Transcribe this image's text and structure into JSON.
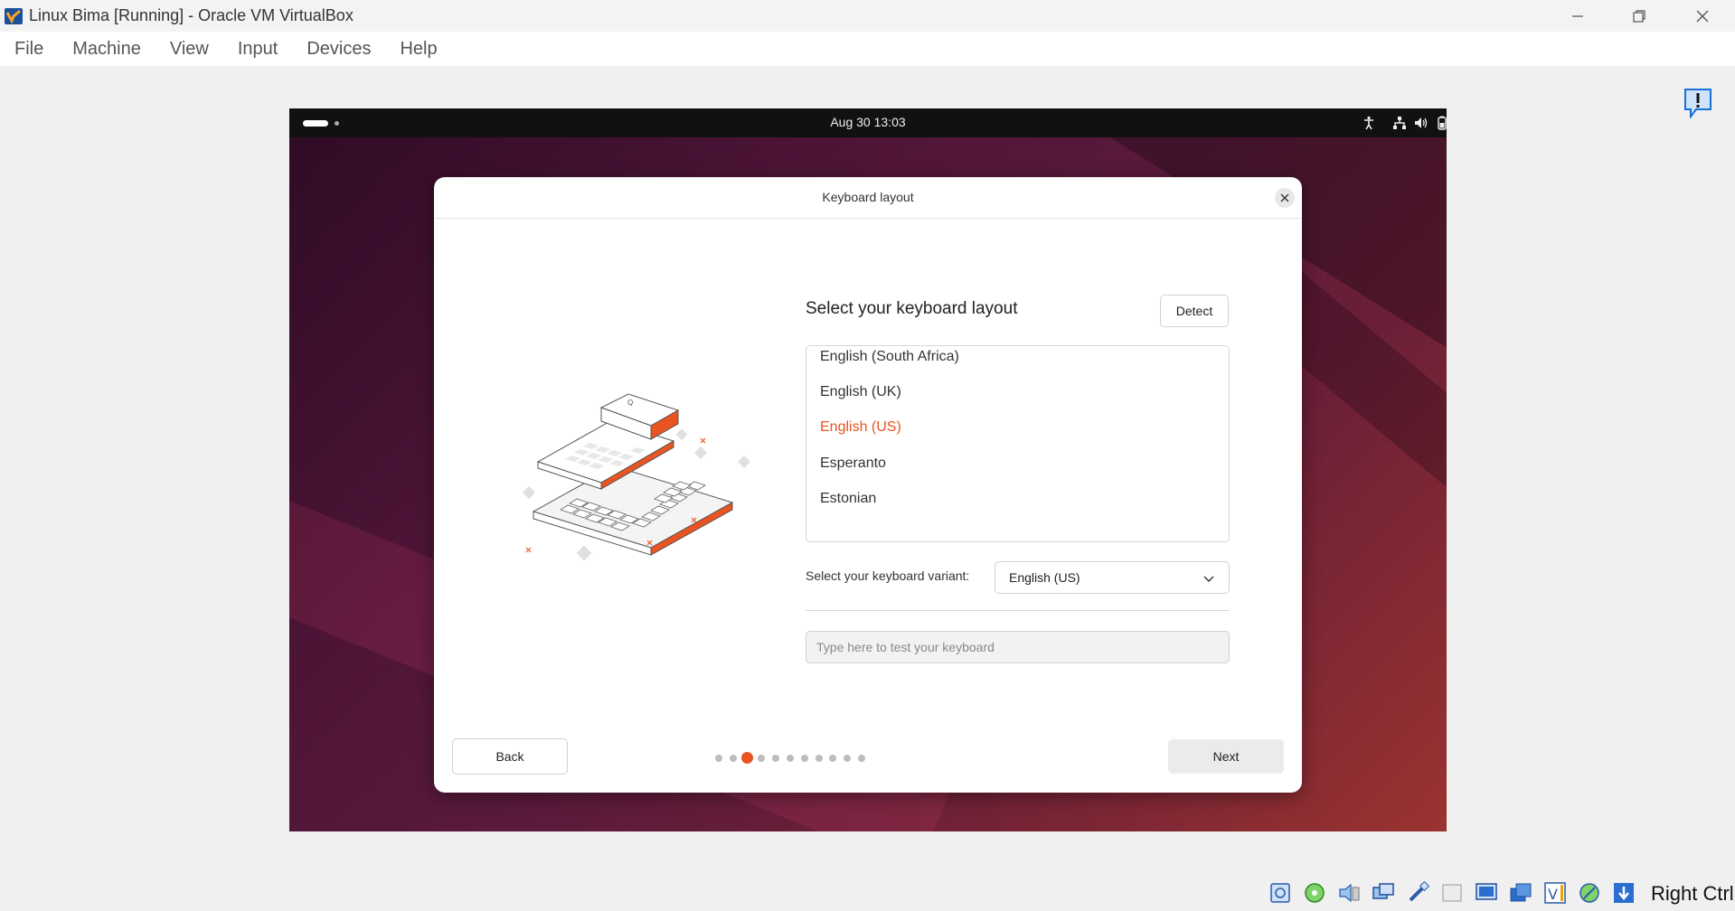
{
  "window": {
    "title": "Linux Bima [Running] - Oracle VM VirtualBox",
    "app_icon": "virtualbox-icon",
    "controls": [
      "minimize-icon",
      "restore-icon",
      "close-icon"
    ]
  },
  "menubar": {
    "items": [
      "File",
      "Machine",
      "View",
      "Input",
      "Devices",
      "Help"
    ]
  },
  "notification_icon": "exclamation-notice-icon",
  "guest": {
    "topbar": {
      "date": "Aug 30",
      "time": "13:03",
      "clock": "Aug 30  13:03",
      "icons": [
        "accessibility-icon",
        "network-icon",
        "volume-icon",
        "battery-icon"
      ]
    },
    "dialog": {
      "title": "Keyboard layout",
      "heading": "Select your keyboard layout",
      "detect_label": "Detect",
      "layouts": [
        "English (South Africa)",
        "English (UK)",
        "English (US)",
        "Esperanto",
        "Estonian"
      ],
      "selected_layout": "English (US)",
      "variant_label": "Select your keyboard variant:",
      "variant_value": "English (US)",
      "test_placeholder": "Type here to test your keyboard",
      "back_label": "Back",
      "next_label": "Next",
      "step_count": 11,
      "current_step": 3
    }
  },
  "statusbar": {
    "icons": [
      "hard-disk-icon",
      "optical-drive-icon",
      "audio-icon",
      "network-adapter-icon",
      "usb-icon",
      "shared-folder-icon",
      "display-icon",
      "recording-icon",
      "cpu-icon",
      "vt-x-icon",
      "mouse-integration-icon",
      "arrow-down-icon"
    ],
    "host_key": "Right Ctrl"
  },
  "colors": {
    "accent": "#e95420",
    "vm_background": "#5a1a3c",
    "topbar": "#111111"
  }
}
